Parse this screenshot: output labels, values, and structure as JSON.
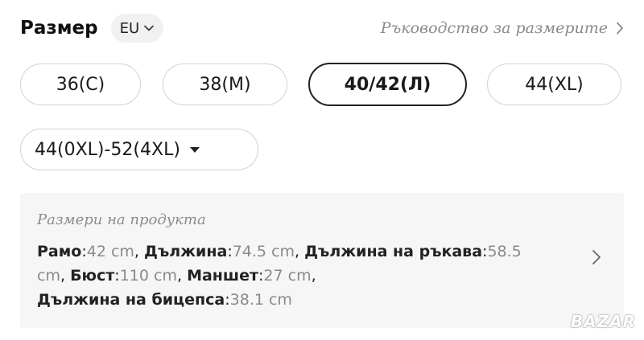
{
  "header": {
    "title": "Размер",
    "region_label": "EU",
    "size_guide_label": "Ръководство за размерите"
  },
  "sizes": [
    {
      "label": "36(С)",
      "selected": false
    },
    {
      "label": "38(М)",
      "selected": false
    },
    {
      "label": "40/42(Л)",
      "selected": true
    },
    {
      "label": "44(XL)",
      "selected": false
    },
    {
      "label": "44(0XL)-52(4XL)",
      "selected": false,
      "has_dropdown": true
    }
  ],
  "details": {
    "title": "Размери на продукта",
    "measurements": [
      {
        "key": "Рамо",
        "value": "42 cm"
      },
      {
        "key": "Дължина",
        "value": "74.5 cm"
      },
      {
        "key": "Дължина на ръкава",
        "value": "58.5 cm"
      },
      {
        "key": "Бюст",
        "value": "110 cm"
      },
      {
        "key": "Маншет",
        "value": "27 cm"
      },
      {
        "key": "Дължина на бицепса",
        "value": "38.1 cm"
      }
    ]
  },
  "watermark": "BAZAR",
  "icons": {
    "region": "chevron-down-icon",
    "guide": "chevron-right-icon",
    "dropdown": "caret-down-icon",
    "details": "chevron-right-icon"
  },
  "colors": {
    "selected_border": "#222222",
    "pill_border": "#d2d2d2",
    "muted_text": "#8a8a8a",
    "panel_bg": "#f6f6f6"
  }
}
